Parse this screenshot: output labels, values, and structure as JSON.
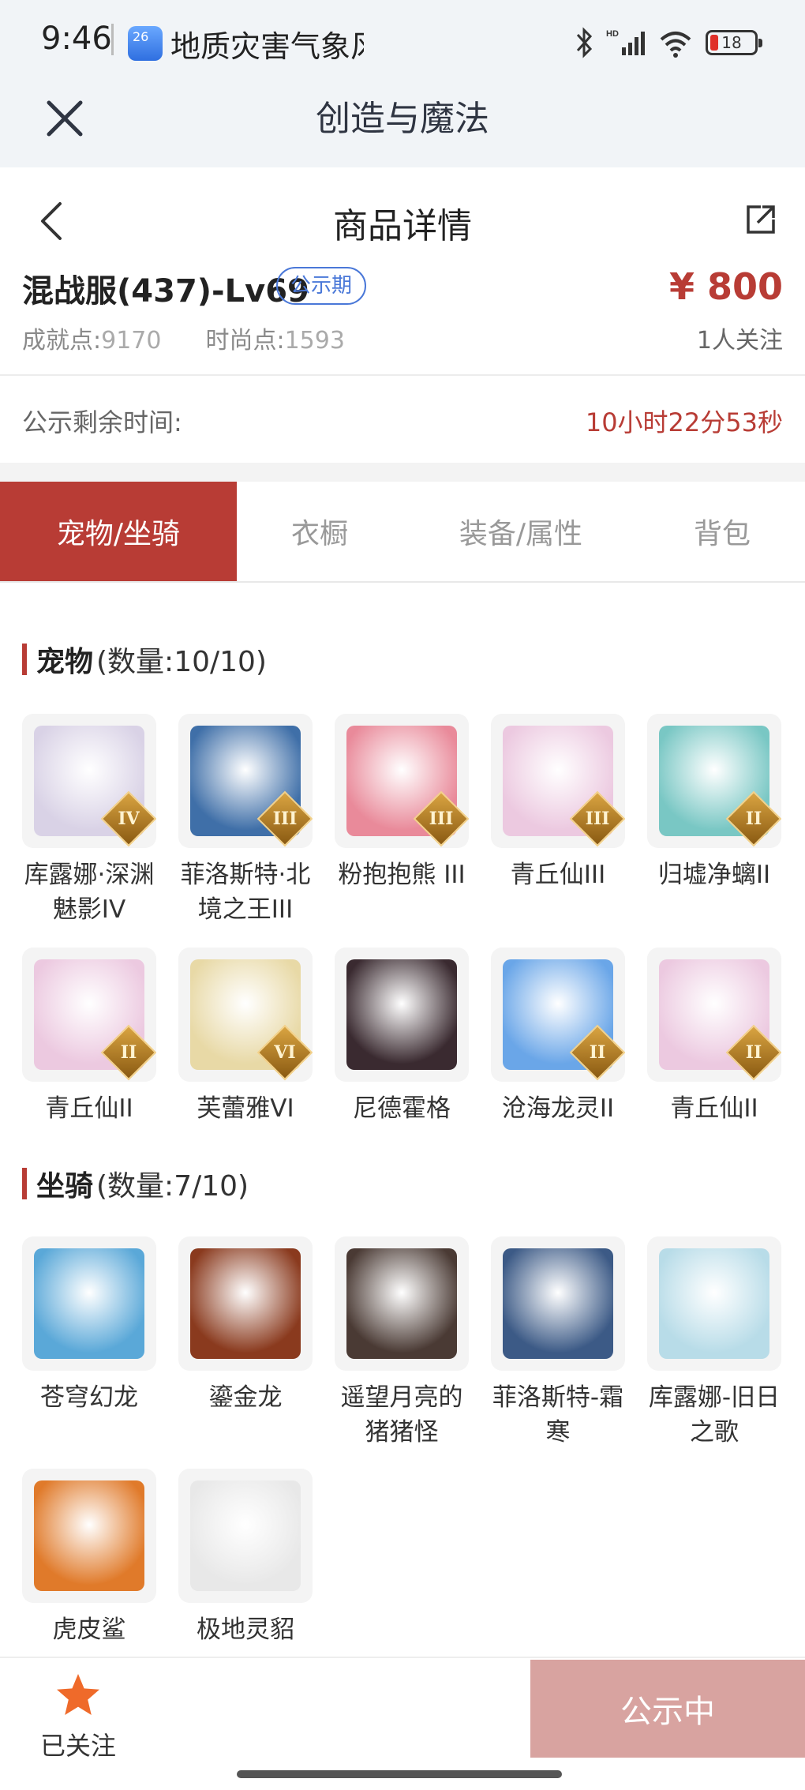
{
  "status_bar": {
    "time": "9:46",
    "app_icon_text": "26",
    "notification": "地质灾害气象风",
    "battery": "18"
  },
  "app": {
    "title": "创造与魔法"
  },
  "detail": {
    "page_title": "商品详情",
    "item_name": "混战服(437)-Lv69",
    "badge": "公示期",
    "price": "¥ 800",
    "achievement_label": "成就点:",
    "achievement_value": "9170",
    "fashion_label": "时尚点:",
    "fashion_value": "1593",
    "followers": "1人关注",
    "timer_label": "公示剩余时间:",
    "timer_value": "10小时22分53秒"
  },
  "tabs": [
    {
      "label": "宠物/坐骑",
      "active": true
    },
    {
      "label": "衣橱",
      "active": false
    },
    {
      "label": "装备/属性",
      "active": false
    },
    {
      "label": "背包",
      "active": false
    }
  ],
  "pets": {
    "title": "宠物",
    "count": "(数量:10/10)",
    "items": [
      {
        "label": "库露娜·深渊魅影IV",
        "tier": "IV",
        "icon": "ghost-maiden-icon",
        "color": "#d9d2e6"
      },
      {
        "label": "菲洛斯特·北境之王III",
        "tier": "III",
        "icon": "ice-king-icon",
        "color": "#3f6fa8"
      },
      {
        "label": "粉抱抱熊 III",
        "tier": "III",
        "icon": "pink-bear-icon",
        "color": "#e98a9a"
      },
      {
        "label": "青丘仙III",
        "tier": "III",
        "icon": "fox-fairy-icon",
        "color": "#ecc9e0"
      },
      {
        "label": "归墟净螭II",
        "tier": "II",
        "icon": "jade-dragon-icon",
        "color": "#79c7c4"
      },
      {
        "label": "青丘仙II",
        "tier": "II",
        "icon": "fox-fairy-icon",
        "color": "#ecc9e0"
      },
      {
        "label": "芙蕾雅VI",
        "tier": "VI",
        "icon": "valkyrie-icon",
        "color": "#e8d9a6"
      },
      {
        "label": "尼德霍格",
        "tier": "",
        "icon": "black-dragon-icon",
        "color": "#3a2a30"
      },
      {
        "label": "沧海龙灵II",
        "tier": "II",
        "icon": "sea-dragon-spirit-icon",
        "color": "#6aa6e8"
      },
      {
        "label": "青丘仙II",
        "tier": "II",
        "icon": "fox-fairy-icon",
        "color": "#ecc9e0"
      }
    ]
  },
  "mounts": {
    "title": "坐骑",
    "count": "(数量:7/10)",
    "items": [
      {
        "label": "苍穹幻龙",
        "icon": "sky-dragon-icon",
        "color": "#5aa8d8"
      },
      {
        "label": "鎏金龙",
        "icon": "golden-dragon-icon",
        "color": "#8a3a1e"
      },
      {
        "label": "遥望月亮的猪猪怪",
        "icon": "pig-monster-icon",
        "color": "#4a3a34"
      },
      {
        "label": "菲洛斯特-霜寒",
        "icon": "frost-king-icon",
        "color": "#3c5a86"
      },
      {
        "label": "库露娜-旧日之歌",
        "icon": "sheep-girl-icon",
        "color": "#b8dce8"
      },
      {
        "label": "虎皮鲨",
        "icon": "tiger-shark-icon",
        "color": "#e07a2a"
      },
      {
        "label": "极地灵貂",
        "icon": "polar-marten-icon",
        "color": "#e8e8e8"
      }
    ]
  },
  "bottom": {
    "follow_label": "已关注",
    "action_label": "公示中"
  },
  "colors": {
    "accent": "#b83c35",
    "badge_blue": "#4a78d8",
    "disabled_button": "#d8a3a0",
    "star": "#ef6a2a"
  }
}
